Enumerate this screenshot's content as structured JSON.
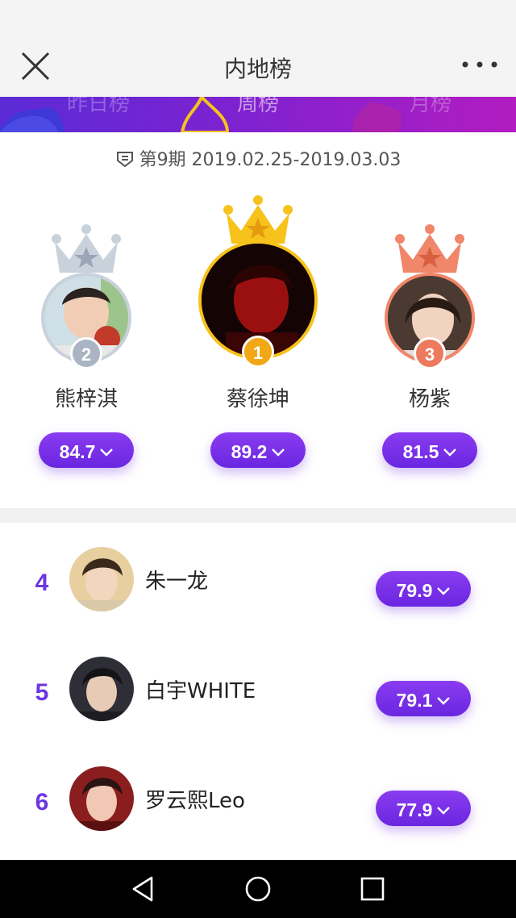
{
  "header": {
    "title": "内地榜"
  },
  "tabs": [
    {
      "label": "昨日榜",
      "active": false
    },
    {
      "label": "周榜",
      "active": true
    },
    {
      "label": "月榜",
      "active": false
    }
  ],
  "period": {
    "text": "第9期 2019.02.25-2019.03.03"
  },
  "podium": [
    {
      "rank": "2",
      "name": "熊梓淇",
      "score": "84.7",
      "crown_color": "#c9d1db",
      "badge_color": "#aab4c2"
    },
    {
      "rank": "1",
      "name": "蔡徐坤",
      "score": "89.2",
      "crown_color": "#f7c21b",
      "badge_color": "#f2a816"
    },
    {
      "rank": "3",
      "name": "杨紫",
      "score": "81.5",
      "crown_color": "#f0866a",
      "badge_color": "#ec7a5e"
    }
  ],
  "list": [
    {
      "rank": "4",
      "name": "朱一龙",
      "score": "79.9"
    },
    {
      "rank": "5",
      "name": "白宇WHITE",
      "score": "79.1"
    },
    {
      "rank": "6",
      "name": "罗云熙Leo",
      "score": "77.9"
    }
  ],
  "colors": {
    "accent": "#6c35e0",
    "gold": "#f7c21b",
    "silver": "#c9d1db",
    "bronze": "#f0866a"
  }
}
